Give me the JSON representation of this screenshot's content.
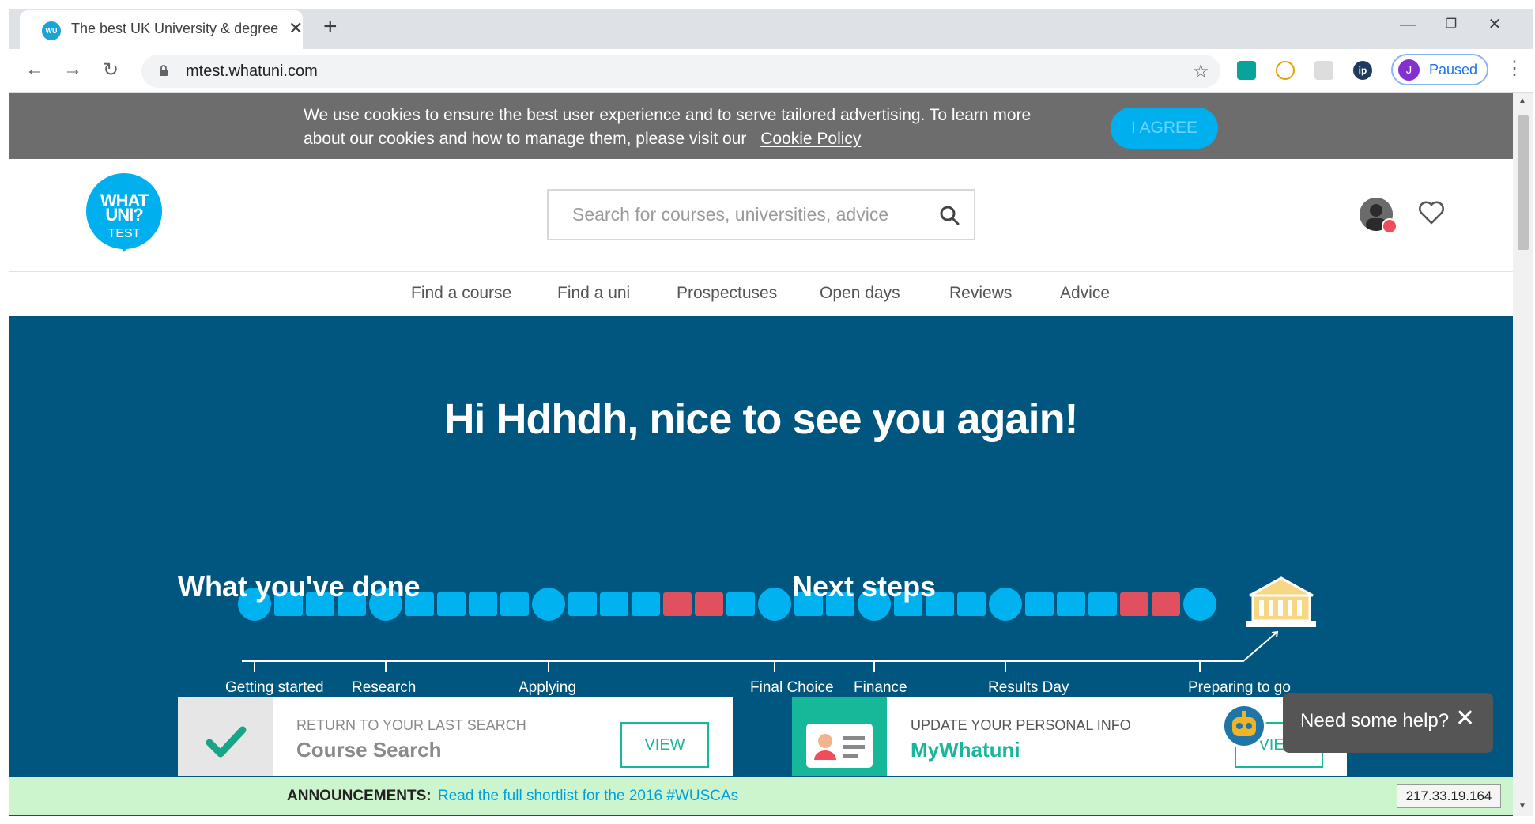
{
  "browser": {
    "tab_title": "The best UK University & degree",
    "favicon_text": "WU",
    "url": "mtest.whatuni.com",
    "profile_initial": "J",
    "profile_status": "Paused"
  },
  "cookie_banner": {
    "message": "We use cookies to ensure the best user experience and to serve tailored advertising. To learn more about our cookies and how to manage them, please visit our",
    "link": "Cookie Policy",
    "agree_button": "I AGREE"
  },
  "header": {
    "logo_line1": "WHAT UNI?",
    "logo_line2": "TEST",
    "search_placeholder": "Search for courses, universities, advice"
  },
  "nav": {
    "items": [
      "Find a course",
      "Find a uni",
      "Prospectuses",
      "Open days",
      "Reviews",
      "Advice"
    ]
  },
  "hero": {
    "greeting": "Hi Hdhdh, nice to see you again!",
    "timeline_stages": [
      "Getting started",
      "Research",
      "Applying",
      "Final Choice",
      "Finance",
      "Results Day",
      "Preparing to go"
    ],
    "timeline_steps": [
      "circle",
      "sq",
      "sq",
      "sq",
      "circle",
      "sq",
      "sq",
      "sq",
      "sq",
      "circle",
      "sq",
      "sq",
      "sq",
      "red",
      "red",
      "sq",
      "circle",
      "sq",
      "sq",
      "circle",
      "sq",
      "sq",
      "sq",
      "circle",
      "sq",
      "sq",
      "sq",
      "red",
      "red",
      "circle"
    ],
    "colors": {
      "step": "#00b3f0",
      "incomplete": "#e0505f",
      "background": "#00567e"
    }
  },
  "done": {
    "title": "What you've done",
    "caption": "RETURN TO YOUR LAST SEARCH",
    "name": "Course Search",
    "button": "VIEW"
  },
  "next": {
    "title": "Next steps",
    "caption": "UPDATE YOUR PERSONAL INFO",
    "name": "MyWhatuni",
    "button": "VIEW"
  },
  "help": {
    "text": "Need some help?"
  },
  "announcement": {
    "label": "ANNOUNCEMENTS:",
    "text": "Read the full shortlist for the 2016 #WUSCAs"
  },
  "ip_badge": "217.33.19.164"
}
